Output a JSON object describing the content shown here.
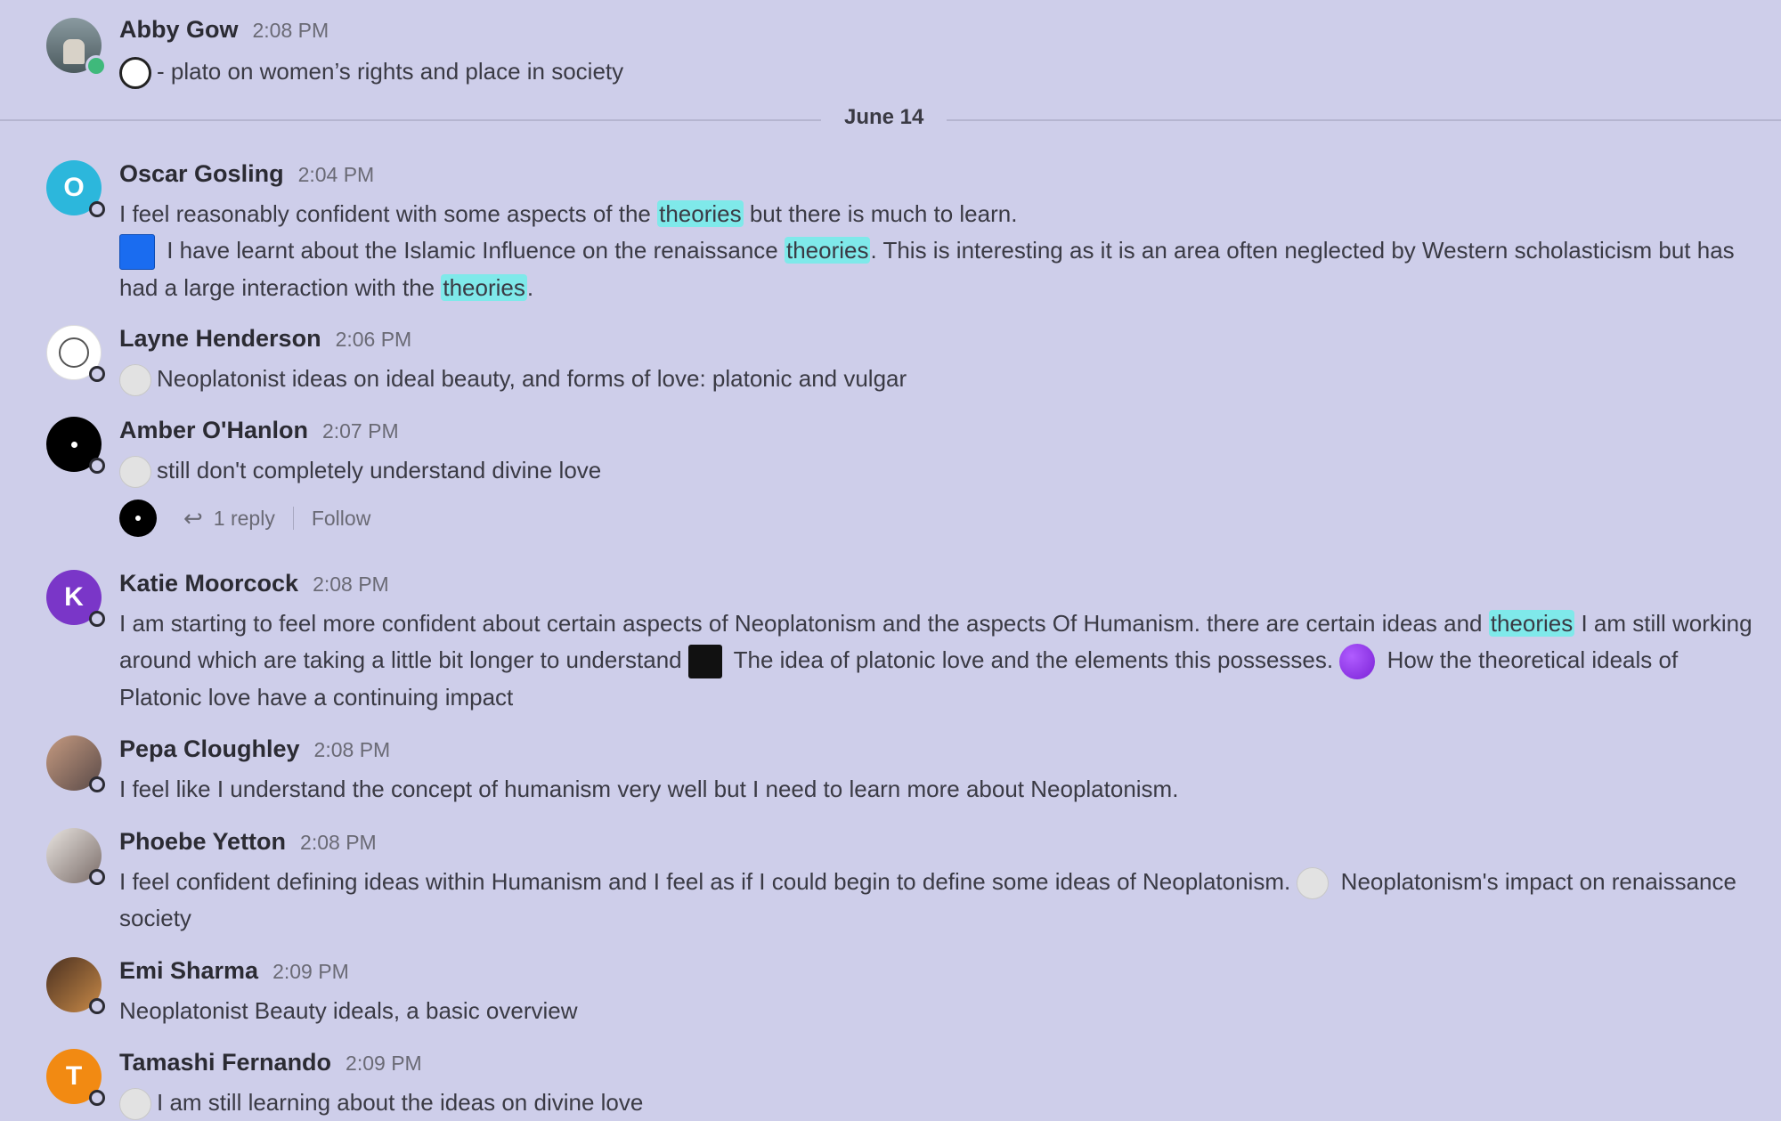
{
  "date_divider": "June 14",
  "messages": [
    {
      "author": "Abby Gow",
      "time": "2:08 PM",
      "text": "- plato on women’s rights and place in society"
    },
    {
      "author": "Oscar Gosling",
      "time": "2:04 PM",
      "initial": "O",
      "line1_a": "I feel reasonably confident with some aspects of the ",
      "hl": "theories",
      "line1_b": " but there is much to learn.",
      "line2_a": " I have learnt about the Islamic Influence on the renaissance ",
      "line2_b": ".  This is interesting as it is an area often neglected by Western scholasticism but has had a large interaction with the ",
      "line2_c": "."
    },
    {
      "author": "Layne Henderson",
      "time": "2:06 PM",
      "text": "Neoplatonist ideas on ideal beauty, and forms of love: platonic and vulgar"
    },
    {
      "author": "Amber O'Hanlon",
      "time": "2:07 PM",
      "text": "still don't completely understand divine love",
      "thread": {
        "replies": "1 reply",
        "follow": "Follow"
      }
    },
    {
      "author": "Katie Moorcock",
      "time": "2:08 PM",
      "initial": "K",
      "a": "I am starting to feel more confident about certain aspects of Neoplatonism and the aspects Of Humanism. there are certain ideas and ",
      "b": " I am still working around which are taking a little bit longer to understand ",
      "c": " The idea of platonic love and the elements this possesses. ",
      "d": " How the theoretical ideals of Platonic love have a continuing impact"
    },
    {
      "author": "Pepa Cloughley",
      "time": "2:08 PM",
      "text": "I feel like I understand the concept of humanism very well but I need to learn more about Neoplatonism."
    },
    {
      "author": "Phoebe Yetton",
      "time": "2:08 PM",
      "a": "I feel confident defining ideas within Humanism and I feel as if I could begin to define some ideas of Neoplatonism. ",
      "b": " Neoplatonism's impact on renaissance society"
    },
    {
      "author": "Emi Sharma",
      "time": "2:09 PM",
      "text": "Neoplatonist Beauty ideals, a basic overview"
    },
    {
      "author": "Tamashi Fernando",
      "time": "2:09 PM",
      "initial": "T",
      "text": "I am still learning about the ideas on divine love"
    }
  ],
  "colors": {
    "oscar": "#2cb7dc",
    "katie": "#7a36c8",
    "tamashi": "#f28a12",
    "highlight": "#7fe9ea"
  }
}
